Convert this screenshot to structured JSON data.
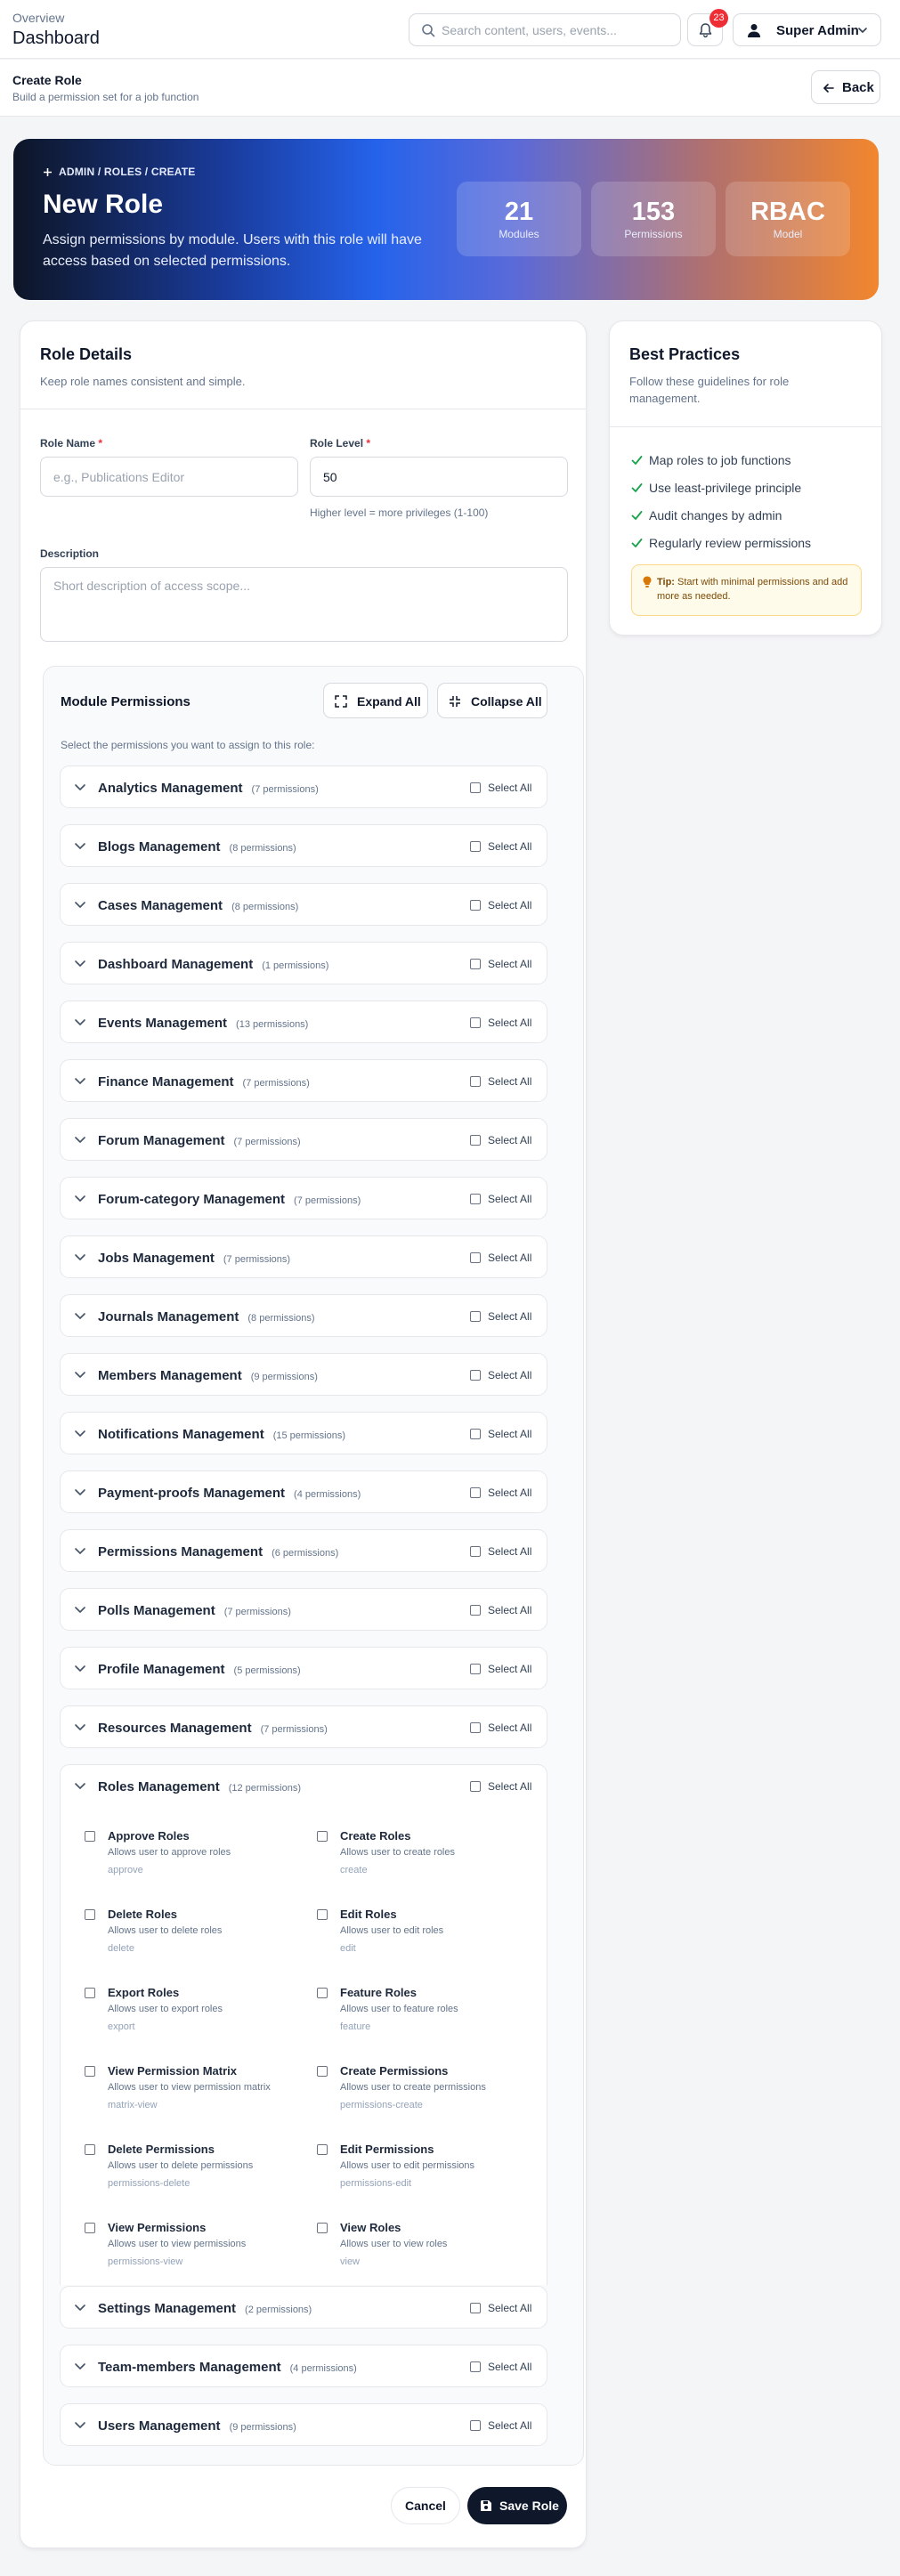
{
  "header": {
    "overline": "Overview",
    "title": "Dashboard",
    "search_placeholder": "Search content, users, events...",
    "notification_count": "23",
    "user_name": "Super Admin"
  },
  "subheader": {
    "title": "Create Role",
    "subtitle": "Build a permission set for a job function",
    "back_label": "Back"
  },
  "hero": {
    "breadcrumb": "ADMIN / ROLES / CREATE",
    "title": "New Role",
    "description": "Assign permissions by module. Users with this role will have access based on selected permissions.",
    "stats": [
      {
        "value": "21",
        "label": "Modules"
      },
      {
        "value": "153",
        "label": "Permissions"
      },
      {
        "value": "RBAC",
        "label": "Model"
      }
    ]
  },
  "role_details": {
    "title": "Role Details",
    "subtitle": "Keep role names consistent and simple.",
    "role_name_label": "Role Name",
    "role_name_placeholder": "e.g., Publications Editor",
    "role_level_label": "Role Level",
    "role_level_value": "50",
    "role_level_hint": "Higher level = more privileges (1-100)",
    "description_label": "Description",
    "description_placeholder": "Short description of access scope...",
    "required_mark": "*"
  },
  "module_permissions": {
    "title": "Module Permissions",
    "expand_all": "Expand All",
    "collapse_all": "Collapse All",
    "subtitle": "Select the permissions you want to assign to this role:",
    "select_all_label": "Select All",
    "modules": [
      {
        "name": "Analytics Management",
        "count": "(7 permissions)"
      },
      {
        "name": "Blogs Management",
        "count": "(8 permissions)"
      },
      {
        "name": "Cases Management",
        "count": "(8 permissions)"
      },
      {
        "name": "Dashboard Management",
        "count": "(1 permissions)"
      },
      {
        "name": "Events Management",
        "count": "(13 permissions)"
      },
      {
        "name": "Finance Management",
        "count": "(7 permissions)"
      },
      {
        "name": "Forum Management",
        "count": "(7 permissions)"
      },
      {
        "name": "Forum-category Management",
        "count": "(7 permissions)"
      },
      {
        "name": "Jobs Management",
        "count": "(7 permissions)"
      },
      {
        "name": "Journals Management",
        "count": "(8 permissions)"
      },
      {
        "name": "Members Management",
        "count": "(9 permissions)"
      },
      {
        "name": "Notifications Management",
        "count": "(15 permissions)"
      },
      {
        "name": "Payment-proofs Management",
        "count": "(4 permissions)"
      },
      {
        "name": "Permissions Management",
        "count": "(6 permissions)"
      },
      {
        "name": "Polls Management",
        "count": "(7 permissions)"
      },
      {
        "name": "Profile Management",
        "count": "(5 permissions)"
      },
      {
        "name": "Resources Management",
        "count": "(7 permissions)"
      },
      {
        "name": "Roles Management",
        "count": "(12 permissions)"
      },
      {
        "name": "Settings Management",
        "count": "(2 permissions)"
      },
      {
        "name": "Team-members Management",
        "count": "(4 permissions)"
      },
      {
        "name": "Users Management",
        "count": "(9 permissions)"
      }
    ],
    "roles_permissions": [
      {
        "name": "Approve Roles",
        "desc": "Allows user to approve roles",
        "key": "approve"
      },
      {
        "name": "Create Roles",
        "desc": "Allows user to create roles",
        "key": "create"
      },
      {
        "name": "Delete Roles",
        "desc": "Allows user to delete roles",
        "key": "delete"
      },
      {
        "name": "Edit Roles",
        "desc": "Allows user to edit roles",
        "key": "edit"
      },
      {
        "name": "Export Roles",
        "desc": "Allows user to export roles",
        "key": "export"
      },
      {
        "name": "Feature Roles",
        "desc": "Allows user to feature roles",
        "key": "feature"
      },
      {
        "name": "View Permission Matrix",
        "desc": "Allows user to view permission matrix",
        "key": "matrix-view"
      },
      {
        "name": "Create Permissions",
        "desc": "Allows user to create permissions",
        "key": "permissions-create"
      },
      {
        "name": "Delete Permissions",
        "desc": "Allows user to delete permissions",
        "key": "permissions-delete"
      },
      {
        "name": "Edit Permissions",
        "desc": "Allows user to edit permissions",
        "key": "permissions-edit"
      },
      {
        "name": "View Permissions",
        "desc": "Allows user to view permissions",
        "key": "permissions-view"
      },
      {
        "name": "View Roles",
        "desc": "Allows user to view roles",
        "key": "view"
      }
    ]
  },
  "actions": {
    "cancel": "Cancel",
    "save": "Save Role"
  },
  "best_practices": {
    "title": "Best Practices",
    "subtitle": "Follow these guidelines for role management.",
    "items": [
      "Map roles to job functions",
      "Use least-privilege principle",
      "Audit changes by admin",
      "Regularly review permissions"
    ],
    "tip_label": "Tip:",
    "tip_text": "Start with minimal permissions and add more as needed."
  },
  "colors": {
    "accent_dark": "#0f172a",
    "check_green": "#16a34a",
    "badge_red": "#ef2d35",
    "tip_bg": "#fffbea"
  }
}
